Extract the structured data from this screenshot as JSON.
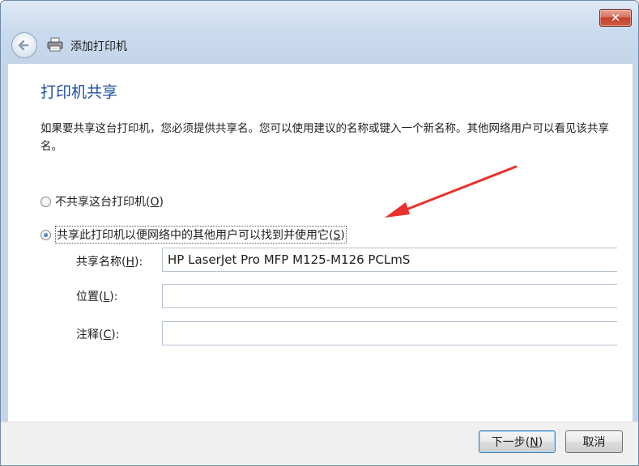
{
  "window": {
    "title": "添加打印机",
    "close_symbol": "✕",
    "back_icon": "back-arrow-icon",
    "printer_icon": "printer-icon"
  },
  "page": {
    "title": "打印机共享",
    "description": "如果要共享这台打印机，您必须提供共享名。您可以使用建议的名称或键入一个新名称。其他网络用户可以看见该共享名。"
  },
  "options": {
    "no_share": {
      "label": "不共享这台打印机(",
      "key": "O",
      "close": ")",
      "checked": false
    },
    "share": {
      "label": "共享此打印机以便网络中的其他用户可以找到并使用它(",
      "key": "S",
      "close": ")",
      "checked": true
    }
  },
  "fields": {
    "share_name": {
      "label": "共享名称(",
      "key": "H",
      "close": "):",
      "value": "HP LaserJet Pro MFP M125-M126 PCLmS"
    },
    "location": {
      "label": "位置(",
      "key": "L",
      "close": "):",
      "value": ""
    },
    "comment": {
      "label": "注释(",
      "key": "C",
      "close": "):",
      "value": ""
    }
  },
  "buttons": {
    "next": {
      "label": "下一步(",
      "key": "N",
      "close": ")"
    },
    "cancel": {
      "label": "取消"
    }
  },
  "colors": {
    "title_blue": "#1d4fa0",
    "annotation_arrow": "#e8322d"
  }
}
